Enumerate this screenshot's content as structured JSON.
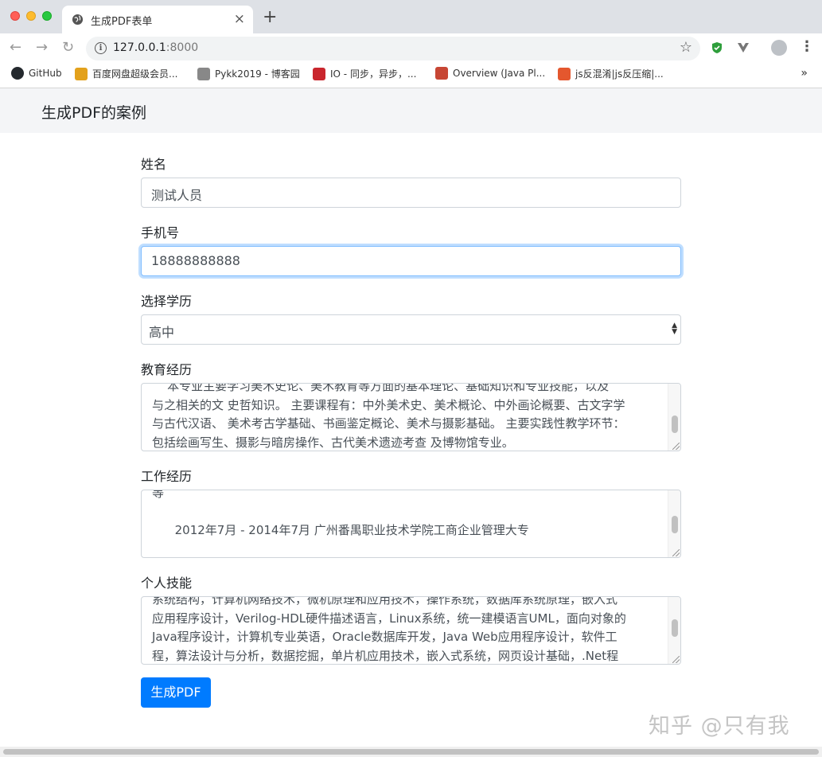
{
  "browser": {
    "tab_title": "生成PDF表单",
    "tab_close": "×",
    "new_tab": "+",
    "url_host": "127.0.0.1",
    "url_port": ":8000",
    "nav": {
      "back": "←",
      "forward": "→",
      "reload": "↻"
    },
    "star": "☆",
    "menu": "⋮",
    "bookmarks": [
      {
        "label": "GitHub",
        "color": "#24292e"
      },
      {
        "label": "百度网盘超级会员...",
        "color": "#e3a11c"
      },
      {
        "label": "Pykk2019 - 博客园",
        "color": "#666666"
      },
      {
        "label": "IO - 同步，异步，...",
        "color": "#c9262d"
      },
      {
        "label": "Overview (Java Pl...",
        "color": "#c74634"
      },
      {
        "label": "js反混淆|js反压缩|...",
        "color": "#e4572e"
      }
    ],
    "bookmarks_more": "»"
  },
  "page": {
    "brand": "生成PDF的案例",
    "fields": {
      "name_label": "姓名",
      "name_value": "测试人员",
      "phone_label": "手机号",
      "phone_value": "18888888888",
      "edu_select_label": "选择学历",
      "edu_select_value": "高中",
      "education_label": "教育经历",
      "education_lines": [
        "    本专业主要学习美术史论、美术教育等方面的基本理论、基础知识和专业技能，以及",
        "与之相关的文 史哲知识。 主要课程有：中外美术史、美术概论、中外画论概要、古文字学",
        "与古代汉语、 美术考古学基础、书画鉴定概论、美术与摄影基础。 主要实践性教学环节：",
        "包括绘画写生、摄影与暗房操作、古代美术遗迹考查 及博物馆专业。"
      ],
      "work_label": "工作经历",
      "work_lines": [
        "等",
        "",
        "      2012年7月 - 2014年7月 广州番禺职业技术学院工商企业管理大专"
      ],
      "skills_label": "个人技能",
      "skills_lines": [
        "系统结构，计算机网络技术，微机原理和应用技术，操作系统，数据库系统原理，嵌入式",
        "应用程序设计，Verilog-HDL硬件描述语言，Linux系统，统一建模语言UML，面向对象的",
        "Java程序设计，计算机专业英语，Oracle数据库开发，Java Web应用程序设计，软件工",
        "程，算法设计与分析，数据挖掘，单片机应用技术，嵌入式系统，网页设计基础，.Net程"
      ]
    },
    "submit_label": "生成PDF"
  },
  "watermark": "知乎 @只有我",
  "colors": {
    "primary": "#007bff",
    "focus": "#80bdff"
  }
}
